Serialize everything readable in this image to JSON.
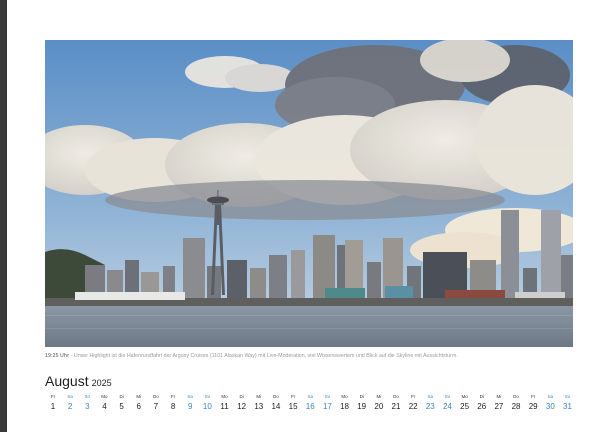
{
  "photo": {
    "subject": "Seattle skyline with Space Needle seen across Elliott Bay under cumulus clouds",
    "colors": {
      "sky_top": "#5f93c9",
      "sky_low": "#a8c4dc",
      "cloud": "#ece7de",
      "cloud_shadow": "#6d6f79",
      "water": "#7d8a98"
    }
  },
  "caption": {
    "time": "19:25 Uhr",
    "text": " - Unser Highlight ist die Hafenrundfahrt der Argosy Cruises (1101 Alaskan Way) mit Live-Moderation, viel Wissenswertem und Blick auf die Skyline mit Aussichtsturm."
  },
  "calendar": {
    "month": "August",
    "year": "2025",
    "weekend_color": "#3f86c8",
    "days": [
      {
        "wd": "Fr",
        "n": "1",
        "we": false
      },
      {
        "wd": "Sa",
        "n": "2",
        "we": true
      },
      {
        "wd": "So",
        "n": "3",
        "we": true
      },
      {
        "wd": "Mo",
        "n": "4",
        "we": false
      },
      {
        "wd": "Di",
        "n": "5",
        "we": false
      },
      {
        "wd": "Mi",
        "n": "6",
        "we": false
      },
      {
        "wd": "Do",
        "n": "7",
        "we": false
      },
      {
        "wd": "Fr",
        "n": "8",
        "we": false
      },
      {
        "wd": "Sa",
        "n": "9",
        "we": true
      },
      {
        "wd": "So",
        "n": "10",
        "we": true
      },
      {
        "wd": "Mo",
        "n": "11",
        "we": false
      },
      {
        "wd": "Di",
        "n": "12",
        "we": false
      },
      {
        "wd": "Mi",
        "n": "13",
        "we": false
      },
      {
        "wd": "Do",
        "n": "14",
        "we": false
      },
      {
        "wd": "Fr",
        "n": "15",
        "we": false
      },
      {
        "wd": "Sa",
        "n": "16",
        "we": true
      },
      {
        "wd": "So",
        "n": "17",
        "we": true
      },
      {
        "wd": "Mo",
        "n": "18",
        "we": false
      },
      {
        "wd": "Di",
        "n": "19",
        "we": false
      },
      {
        "wd": "Mi",
        "n": "20",
        "we": false
      },
      {
        "wd": "Do",
        "n": "21",
        "we": false
      },
      {
        "wd": "Fr",
        "n": "22",
        "we": false
      },
      {
        "wd": "Sa",
        "n": "23",
        "we": true
      },
      {
        "wd": "So",
        "n": "24",
        "we": true
      },
      {
        "wd": "Mo",
        "n": "25",
        "we": false
      },
      {
        "wd": "Di",
        "n": "26",
        "we": false
      },
      {
        "wd": "Mi",
        "n": "27",
        "we": false
      },
      {
        "wd": "Do",
        "n": "28",
        "we": false
      },
      {
        "wd": "Fr",
        "n": "29",
        "we": false
      },
      {
        "wd": "Sa",
        "n": "30",
        "we": true
      },
      {
        "wd": "So",
        "n": "31",
        "we": true
      }
    ]
  }
}
